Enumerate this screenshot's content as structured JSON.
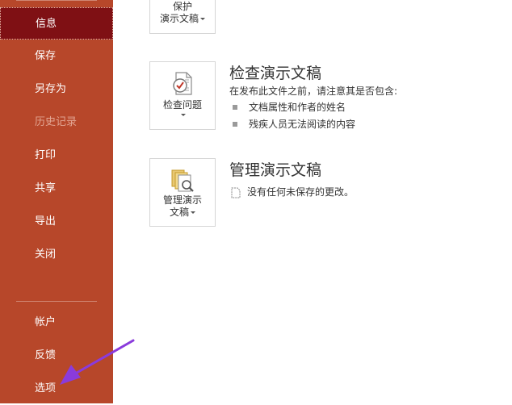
{
  "sidebar": {
    "items": [
      {
        "label": "信息"
      },
      {
        "label": "保存"
      },
      {
        "label": "另存为"
      },
      {
        "label": "历史记录"
      },
      {
        "label": "打印"
      },
      {
        "label": "共享"
      },
      {
        "label": "导出"
      },
      {
        "label": "关闭"
      },
      {
        "label": "帐户"
      },
      {
        "label": "反馈"
      },
      {
        "label": "选项"
      }
    ]
  },
  "protect": {
    "tile_line1": "保护",
    "tile_line2": "演示文稿"
  },
  "inspect": {
    "tile_label": "检查问题",
    "title": "检查演示文稿",
    "description": "在发布此文件之前，请注意其是否包含:",
    "bullets": [
      "文档属性和作者的姓名",
      "残疾人员无法阅读的内容"
    ]
  },
  "manage": {
    "tile_line1": "管理演示",
    "tile_line2": "文稿",
    "title": "管理演示文稿",
    "note": "没有任何未保存的更改。"
  },
  "colors": {
    "sidebar": "#b7472a",
    "sidebar_active": "#7f1014",
    "annotation_arrow": "#8a3bdc"
  }
}
